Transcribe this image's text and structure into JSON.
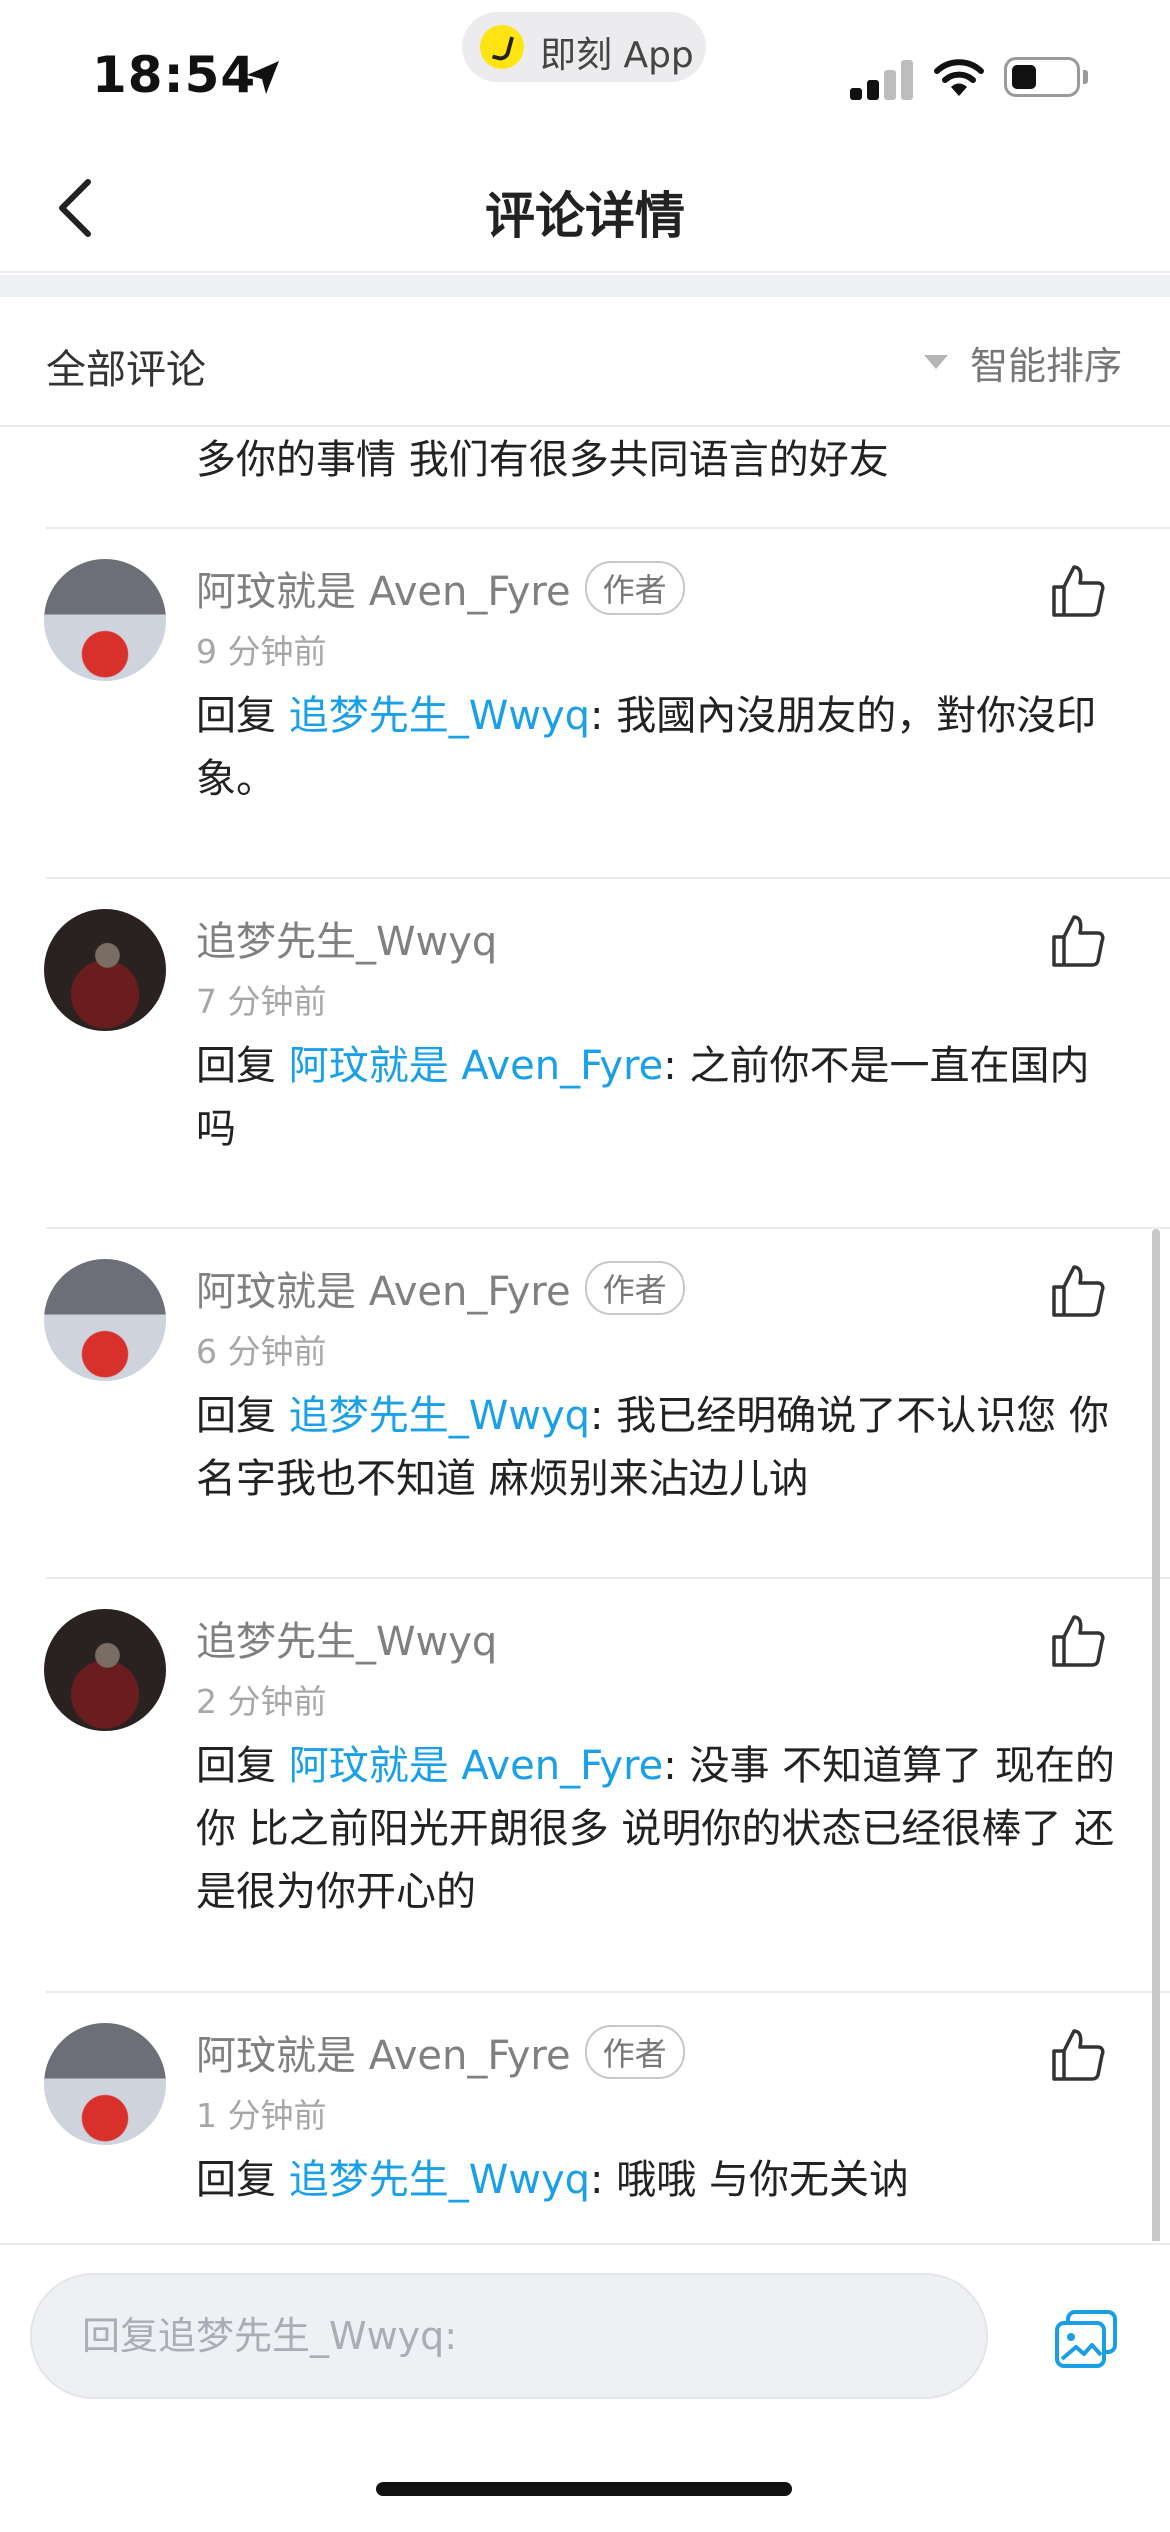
{
  "status_bar": {
    "time": "18:54",
    "app_name": "即刻 App",
    "accent_yellow": "#ffe411"
  },
  "nav": {
    "title": "评论详情"
  },
  "sort_header": {
    "section_title": "全部评论",
    "sort_label": "智能排序"
  },
  "top_fragment": "多你的事情 我们有很多共同语言的好友",
  "comments": [
    {
      "author": "阿玟就是 Aven_Fyre",
      "badge": "作者",
      "time": "9 分钟前",
      "reply_prefix": "回复 ",
      "mention": "追梦先生_Wwyq",
      "text": ": 我國內沒朋友的，對你沒印象。",
      "avatar": "avatar-red-dress"
    },
    {
      "author": "追梦先生_Wwyq",
      "badge": "",
      "time": "7 分钟前",
      "reply_prefix": "回复 ",
      "mention": "阿玟就是 Aven_Fyre",
      "text": ": 之前你不是一直在国内吗",
      "avatar": "avatar-dark-portrait"
    },
    {
      "author": "阿玟就是 Aven_Fyre",
      "badge": "作者",
      "time": "6 分钟前",
      "reply_prefix": "回复 ",
      "mention": "追梦先生_Wwyq",
      "text": ": 我已经明确说了不认识您 你名字我也不知道 麻烦别来沾边儿讷",
      "avatar": "avatar-red-dress"
    },
    {
      "author": "追梦先生_Wwyq",
      "badge": "",
      "time": "2 分钟前",
      "reply_prefix": "回复 ",
      "mention": "阿玟就是 Aven_Fyre",
      "text": ": 没事 不知道算了 现在的你 比之前阳光开朗很多 说明你的状态已经很棒了  还是很为你开心的",
      "avatar": "avatar-dark-portrait"
    },
    {
      "author": "阿玟就是 Aven_Fyre",
      "badge": "作者",
      "time": "1 分钟前",
      "reply_prefix": "回复 ",
      "mention": "追梦先生_Wwyq",
      "text": ": 哦哦 与你无关讷",
      "avatar": "avatar-red-dress"
    }
  ],
  "input": {
    "placeholder": "回复追梦先生_Wwyq:"
  },
  "colors": {
    "mention": "#1aa0e8",
    "icon_blue": "#1a9fe6"
  }
}
